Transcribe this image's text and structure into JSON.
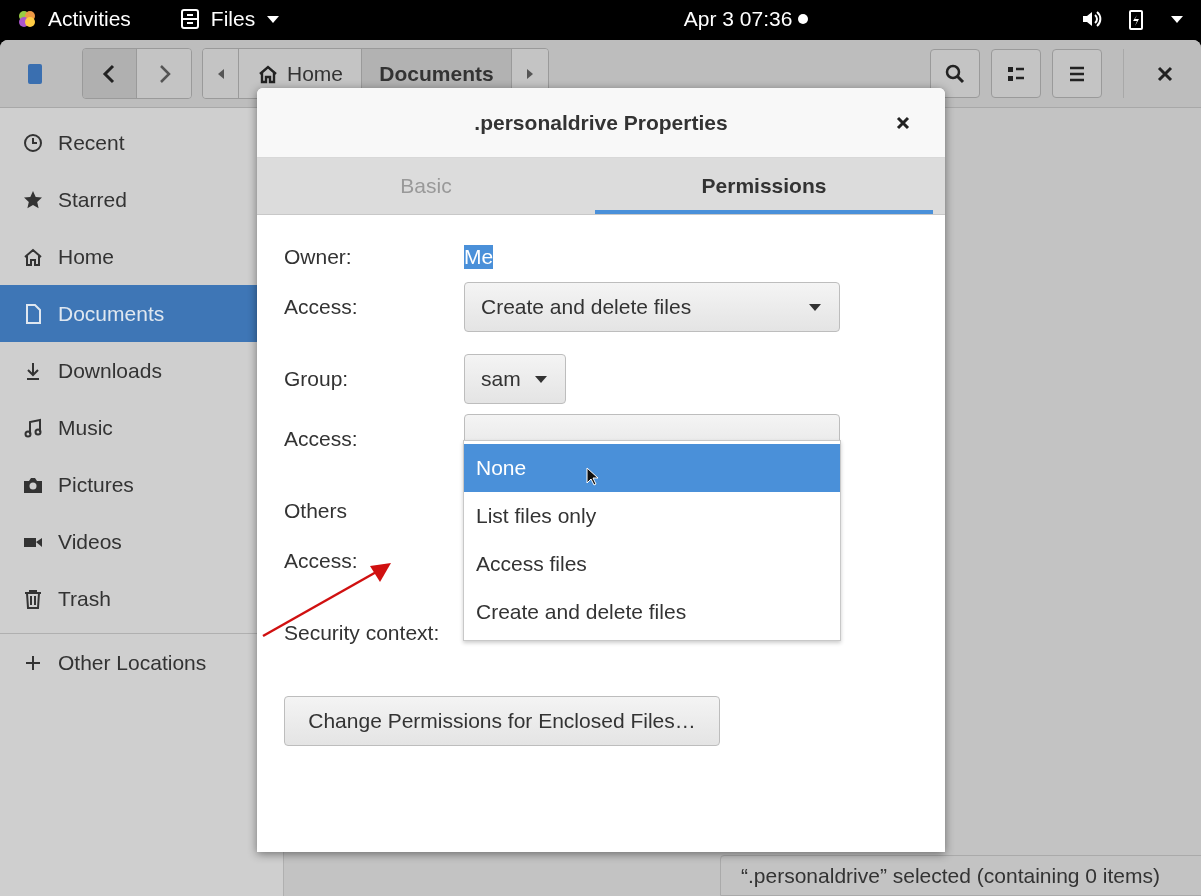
{
  "top_bar": {
    "activities": "Activities",
    "app_menu": "Files",
    "clock": "Apr 3  07:36"
  },
  "header": {
    "path": [
      {
        "label": "Home",
        "selected": false
      },
      {
        "label": "Documents",
        "selected": true
      }
    ]
  },
  "sidebar": {
    "items": [
      {
        "label": "Recent",
        "selected": false
      },
      {
        "label": "Starred",
        "selected": false
      },
      {
        "label": "Home",
        "selected": false
      },
      {
        "label": "Documents",
        "selected": true
      },
      {
        "label": "Downloads",
        "selected": false
      },
      {
        "label": "Music",
        "selected": false
      },
      {
        "label": "Pictures",
        "selected": false
      },
      {
        "label": "Videos",
        "selected": false
      },
      {
        "label": "Trash",
        "selected": false
      }
    ],
    "other": {
      "label": "Other Locations",
      "selected": false
    }
  },
  "status_bar": "“.personaldrive” selected  (containing 0 items)",
  "dialog": {
    "title": ".personaldrive Properties",
    "tabs": [
      {
        "label": "Basic",
        "selected": false
      },
      {
        "label": "Permissions",
        "selected": true
      }
    ],
    "sections": [
      {
        "kind": "text",
        "label": "Owner:",
        "value": "Me",
        "highlighted": true,
        "access_label": "Access:",
        "access_value": "Create and delete files"
      },
      {
        "kind": "combo",
        "label": "Group:",
        "value": "sam",
        "access_label": "Access:"
      },
      {
        "kind": "heading",
        "label": "Others",
        "access_label": "Access:"
      }
    ],
    "security_label": "Security context:",
    "button": "Change Permissions for Enclosed Files…",
    "menu": [
      {
        "label": "None",
        "selected": true
      },
      {
        "label": "List files only",
        "selected": false
      },
      {
        "label": "Access files",
        "selected": false
      },
      {
        "label": "Create and delete files",
        "selected": false
      }
    ]
  }
}
